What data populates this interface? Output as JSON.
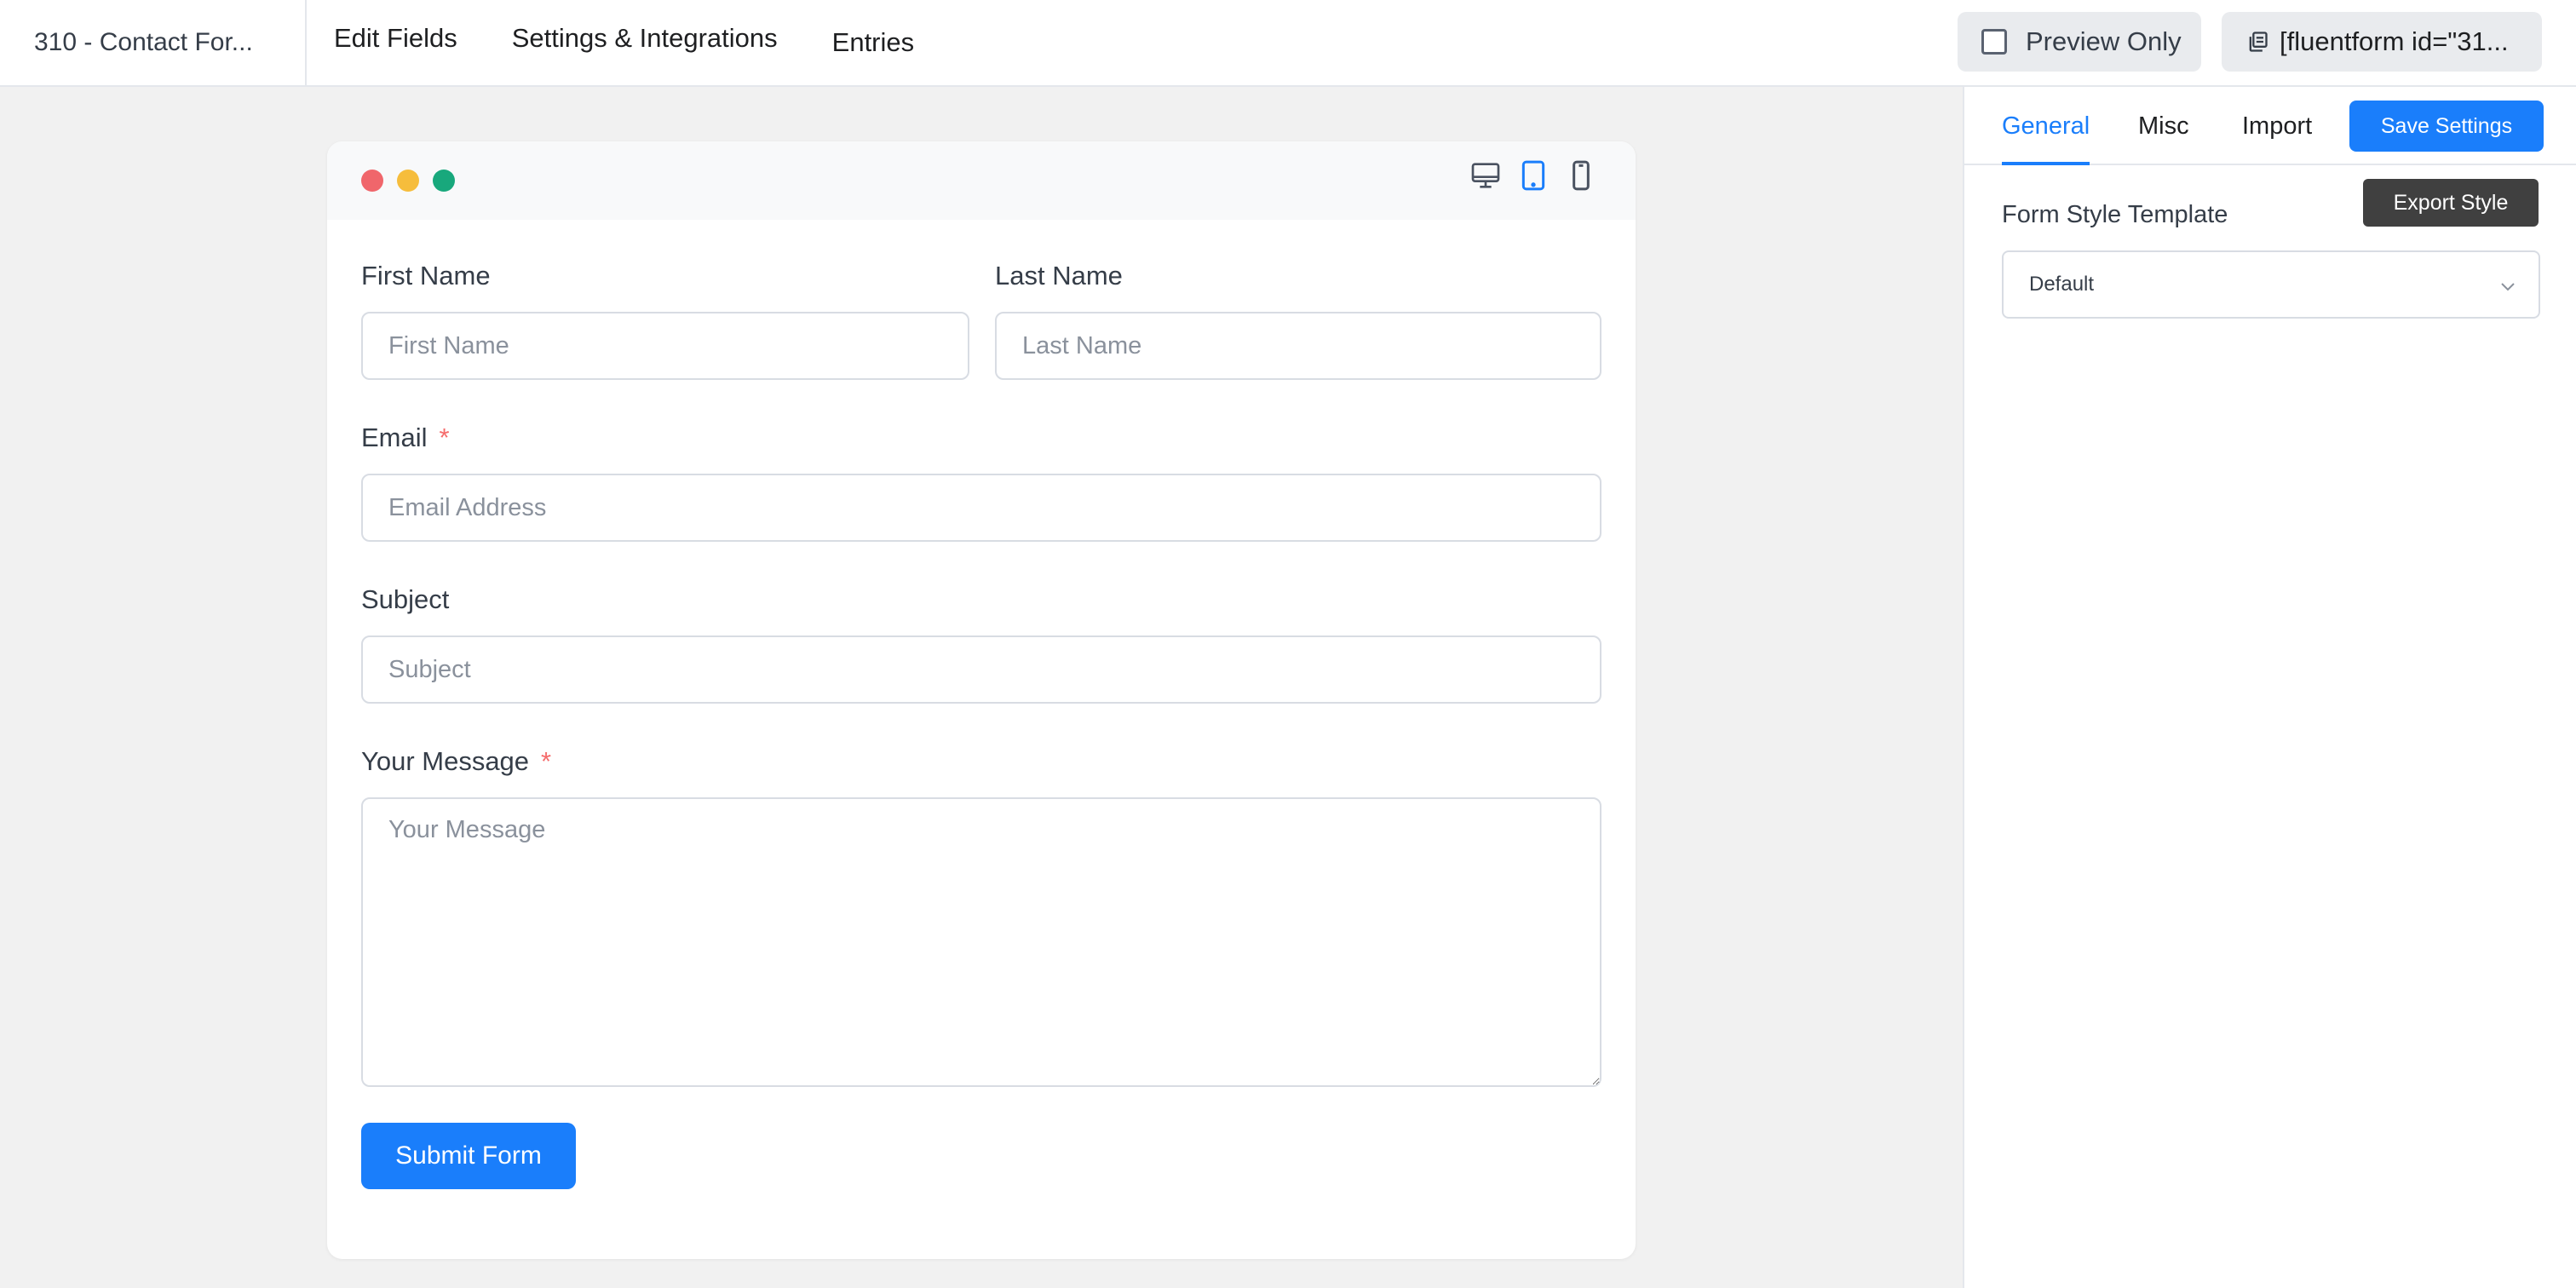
{
  "header": {
    "form_title": "310 - Contact For...",
    "nav": [
      "Edit Fields",
      "Settings & Integrations",
      "Entries"
    ],
    "preview_label": "Preview Only",
    "shortcode": "[fluentform id=\"31..."
  },
  "preview": {
    "devices": [
      "desktop-icon",
      "tablet-icon",
      "mobile-icon"
    ],
    "active_device": "tablet",
    "fields": {
      "first_name": {
        "label": "First Name",
        "placeholder": "First Name"
      },
      "last_name": {
        "label": "Last Name",
        "placeholder": "Last Name"
      },
      "email": {
        "label": "Email",
        "placeholder": "Email Address",
        "required": "*"
      },
      "subject": {
        "label": "Subject",
        "placeholder": "Subject"
      },
      "message": {
        "label": "Your Message",
        "placeholder": "Your Message",
        "required": "*"
      }
    },
    "submit_label": "Submit Form"
  },
  "panel": {
    "tabs": [
      "General",
      "Misc",
      "Import"
    ],
    "active_tab": "General",
    "save_label": "Save Settings",
    "tooltip": "Export Style",
    "template_label": "Form Style Template",
    "template_value": "Default"
  },
  "colors": {
    "accent": "#1a7efb",
    "required": "#f56c6c",
    "window_dots": [
      "#f0666b",
      "#f6bd3c",
      "#18a87c"
    ]
  }
}
